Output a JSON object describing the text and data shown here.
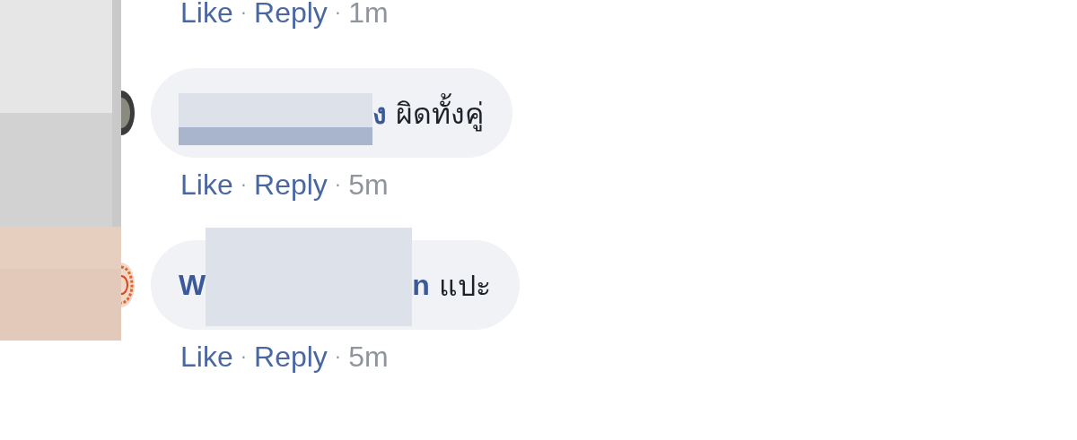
{
  "top_actions": {
    "like": "Like",
    "separator_1": "·",
    "reply": "Reply",
    "separator_2": "·",
    "time": "1m"
  },
  "comments": [
    {
      "redacted": true,
      "name_after": "ง",
      "text": "ผิดทั้งคู่",
      "actions": {
        "like": "Like",
        "separator_1": "·",
        "reply": "Reply",
        "separator_2": "·",
        "time": "5m"
      }
    },
    {
      "name_before": "W",
      "redacted": true,
      "name_after": "n",
      "text": "แปะ",
      "actions": {
        "like": "Like",
        "separator_1": "·",
        "reply": "Reply",
        "separator_2": "·",
        "time": "5m"
      }
    }
  ]
}
